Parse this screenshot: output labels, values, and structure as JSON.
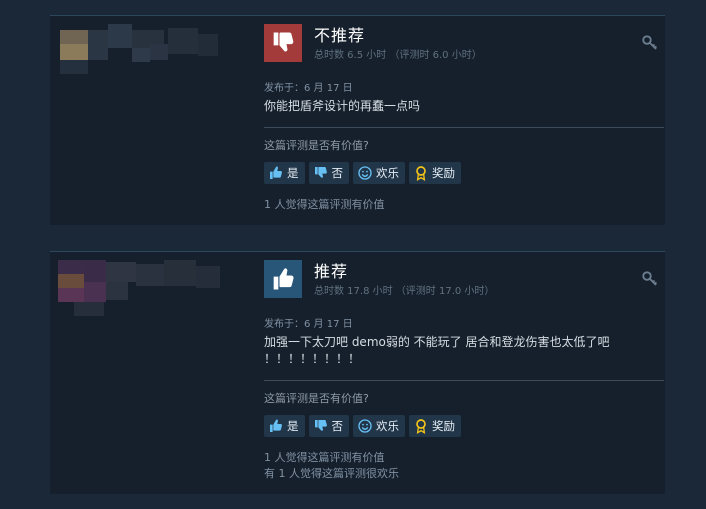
{
  "reviews": [
    {
      "verdict": "不推荐",
      "recommended": false,
      "hours": "总时数 6.5 小时 （评测时 6.0 小时）",
      "posted": "发布于：6 月 17 日",
      "content": "你能把盾斧设计的再蠢一点吗",
      "question": "这篇评测是否有价值?",
      "buttons": {
        "yes": "是",
        "no": "否",
        "funny": "欢乐",
        "award": "奖励"
      },
      "helpful": [
        "1 人觉得这篇评测有价值"
      ]
    },
    {
      "verdict": "推荐",
      "recommended": true,
      "hours": "总时数 17.8 小时 （评测时 17.0 小时）",
      "posted": "发布于：6 月 17 日",
      "content": "加强一下太刀吧 demo弱的 不能玩了 居合和登龙伤害也太低了吧\n！！！！！！！！",
      "question": "这篇评测是否有价值?",
      "buttons": {
        "yes": "是",
        "no": "否",
        "funny": "欢乐",
        "award": "奖励"
      },
      "helpful": [
        "1 人觉得这篇评测有价值",
        "有 1 人觉得这篇评测很欢乐"
      ]
    }
  ],
  "colors": {
    "page_bg": "#1b2838",
    "card_bg": "#16202d",
    "not_recommended": "#a33b3b",
    "recommended": "#275678",
    "button_bg": "#223649",
    "award_gold": "#f5c518"
  },
  "icons": [
    "thumbs-down-icon",
    "thumbs-up-icon",
    "key-icon",
    "smiley-icon",
    "award-ribbon-icon"
  ]
}
